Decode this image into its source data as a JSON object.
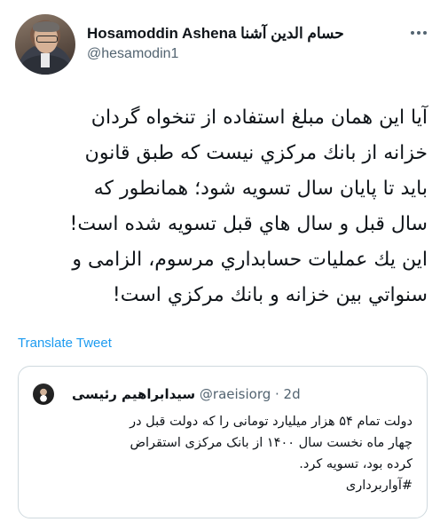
{
  "author": {
    "display_name": "Hosamoddin Ashena حسام الدين آشنا",
    "handle": "@hesamodin1"
  },
  "icons": {
    "more": "more-horizontal-icon"
  },
  "tweet": {
    "text": "آيا اين همان مبلغ استفاده از تنخواه گردان\nخزانه از بانك مركزي نيست كه طبق قانون\nبايد تا پايان سال تسويه شود؛ همانطور كه\nسال قبل و سال هاي قبل تسويه شده است!\nاين يك عمليات حسابداري مرسوم، الزامی و\nسنواتي بين خزانه و بانك مركزي است!"
  },
  "translate_label": "Translate Tweet",
  "quoted_tweet": {
    "name": "سیدابراهیم رئیسی",
    "meta": "@raeisiorg · 2d",
    "text": "دولت تمام ۵۴ هزار میلیارد تومانی را که دولت قبل در\nچهار ماه نخست سال ۱۴۰۰ از بانک مرکزی استقراض\nکرده بود، تسویه کرد.\n#آوار‌برداری"
  },
  "colors": {
    "link": "#1d9bf0",
    "secondary": "#536471",
    "border": "#cfd9de"
  }
}
